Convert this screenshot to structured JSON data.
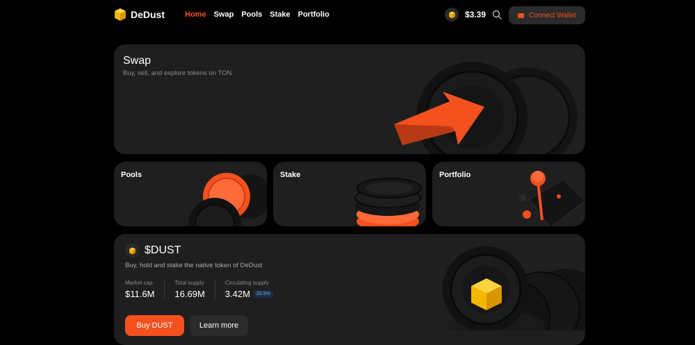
{
  "header": {
    "logo_text": "DeDust",
    "nav": [
      {
        "label": "Home",
        "active": true
      },
      {
        "label": "Swap",
        "active": false
      },
      {
        "label": "Pools",
        "active": false
      },
      {
        "label": "Stake",
        "active": false
      },
      {
        "label": "Portfolio",
        "active": false
      }
    ],
    "price": "$3.39",
    "connect_label": "Connect Wallet"
  },
  "swap_card": {
    "title": "Swap",
    "subtitle": "Buy, sell, and explore tokens on TON"
  },
  "cards": {
    "pools": "Pools",
    "stake": "Stake",
    "portfolio": "Portfolio"
  },
  "dust": {
    "title": "$DUST",
    "subtitle": "Buy, hold and stake the native token of DeDust",
    "stats": {
      "market_cap_label": "Market cap",
      "market_cap_value": "$11.6M",
      "total_supply_label": "Total supply",
      "total_supply_value": "16.69M",
      "circulating_label": "Circulating supply",
      "circulating_value": "3.42M",
      "circulating_badge": "20.5%"
    },
    "buy_label": "Buy DUST",
    "learn_label": "Learn more"
  },
  "colors": {
    "accent": "#f4511e",
    "card_bg": "#1f1f1f",
    "page_bg": "#000000",
    "brand_yellow": "#f5b800"
  }
}
